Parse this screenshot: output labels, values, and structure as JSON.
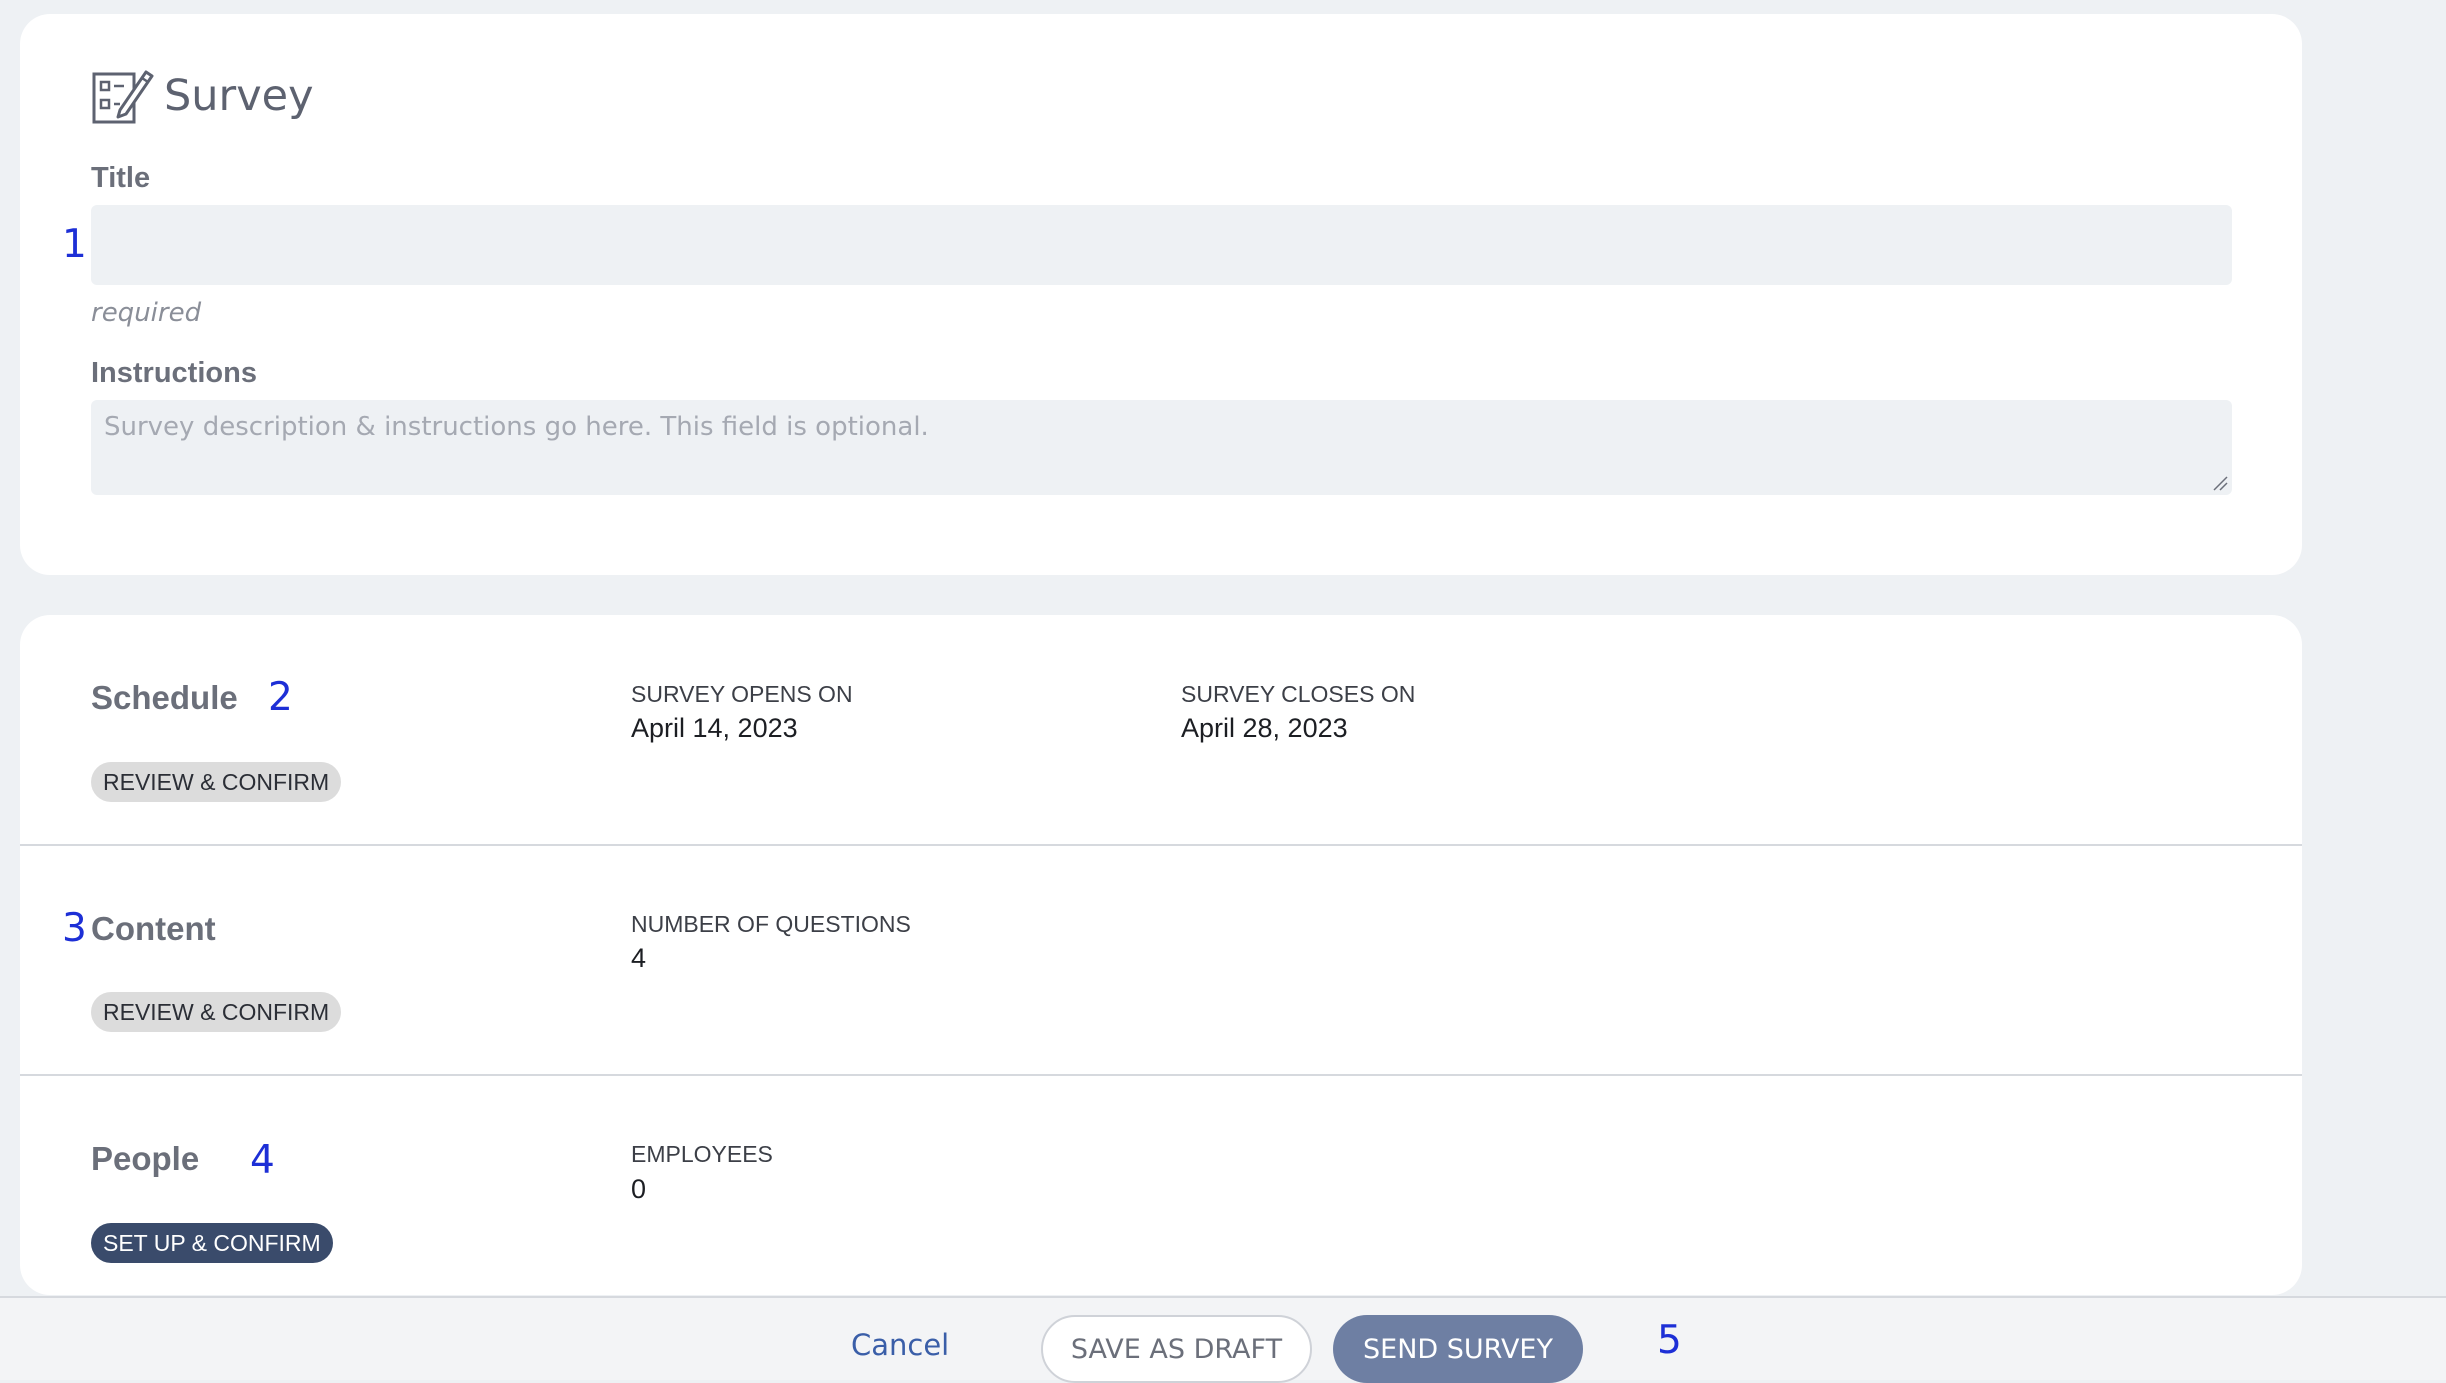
{
  "survey": {
    "heading": "Survey",
    "icon": "survey-edit-icon",
    "title_label": "Title",
    "title_value": "",
    "title_helper": "required",
    "instructions_label": "Instructions",
    "instructions_placeholder": "Survey description & instructions go here.  This field is optional.",
    "instructions_value": ""
  },
  "sections": {
    "schedule": {
      "title": "Schedule",
      "action": "REVIEW & CONFIRM",
      "opens_label": "SURVEY OPENS ON",
      "opens_value": "April 14, 2023",
      "closes_label": "SURVEY CLOSES ON",
      "closes_value": "April 28, 2023"
    },
    "content": {
      "title": "Content",
      "action": "REVIEW & CONFIRM",
      "questions_label": "NUMBER OF QUESTIONS",
      "questions_value": "4"
    },
    "people": {
      "title": "People",
      "action": "SET UP & CONFIRM",
      "employees_label": "EMPLOYEES",
      "employees_value": "0"
    }
  },
  "footer": {
    "cancel_label": "Cancel",
    "draft_label": "SAVE AS DRAFT",
    "send_label": "SEND SURVEY"
  },
  "markers": {
    "m1": "1",
    "m2": "2",
    "m3": "3",
    "m4": "4",
    "m5": "5"
  },
  "colors": {
    "page_background": "#eef1f4",
    "card_background": "#ffffff",
    "input_background": "#eef1f4",
    "marker": "#1d2fd6",
    "link": "#3a5ea8",
    "primary_button": "#6e7fa3",
    "pill_dark": "#3a4b6b",
    "pill_light": "#dcdcdc"
  }
}
